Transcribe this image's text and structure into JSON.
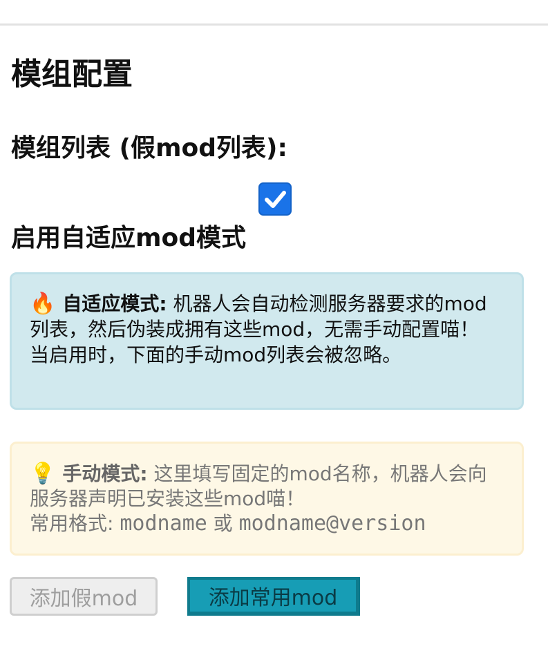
{
  "page": {
    "section_title": "模组配置",
    "list_label": "模组列表 (假mod列表):",
    "adaptive_checkbox": {
      "checked": true
    },
    "adaptive_label": "启用自适应mod模式"
  },
  "info_box": {
    "icon": "fire-emoji",
    "emoji": "🔥",
    "title": "自适应模式:",
    "text_line1": " 机器人会自动检测服务器要求的mod列表，然后伪装成拥有这些mod，无需手动配置喵！",
    "text_line2": "当启用时，下面的手动mod列表会被忽略。"
  },
  "tip_box": {
    "icon": "lightbulb-emoji",
    "emoji": "💡",
    "title": "手动模式:",
    "text_line1": " 这里填写固定的mod名称，机器人会向服务器声明已安装这些mod喵！",
    "format_prefix": "常用格式: ",
    "format_a": "modname",
    "format_or": " 或 ",
    "format_b": "modname@version"
  },
  "buttons": {
    "add_fake_mod": "添加假mod",
    "add_common_mod": "添加常用mod"
  },
  "colors": {
    "checkbox": "#1a73e8",
    "info_bg": "#d1e9ee",
    "tip_bg": "#fef8e6",
    "primary_button": "#179db5"
  }
}
